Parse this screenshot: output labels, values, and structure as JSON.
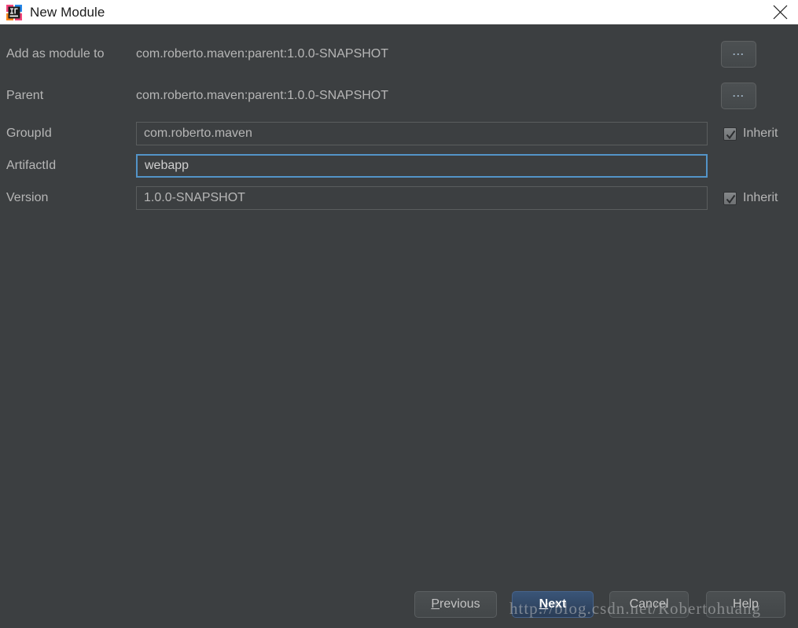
{
  "window": {
    "title": "New Module",
    "app_icon": "intellij-idea-icon",
    "close_icon": "close-icon",
    "titlebar_bg": "#ffffff",
    "body_bg": "#3c3f41"
  },
  "form": {
    "rows": [
      {
        "label": "Add as module to",
        "value": "com.roberto.maven:parent:1.0.0-SNAPSHOT",
        "browse_label": "...",
        "name": "add-as-module-to"
      },
      {
        "label": "Parent",
        "value": "com.roberto.maven:parent:1.0.0-SNAPSHOT",
        "browse_label": "...",
        "name": "parent"
      }
    ],
    "fields": [
      {
        "label": "GroupId",
        "value": "com.roberto.maven",
        "name": "groupid",
        "focused": false,
        "inherit_label": "Inherit",
        "inherit_checked": true
      },
      {
        "label": "ArtifactId",
        "value": "webapp",
        "name": "artifactid",
        "focused": true,
        "inherit_label": "",
        "inherit_checked": false
      },
      {
        "label": "Version",
        "value": "1.0.0-SNAPSHOT",
        "name": "version",
        "focused": false,
        "inherit_label": "Inherit",
        "inherit_checked": true
      }
    ]
  },
  "footer": {
    "previous": {
      "label": "Previous",
      "mnemonic": "P"
    },
    "next": {
      "label": "Next",
      "mnemonic": "N"
    },
    "cancel": {
      "label": "Cancel"
    },
    "help": {
      "label": "Help"
    },
    "default_button_color": "#2f4a6b"
  },
  "watermark": {
    "text": "http://blog.csdn.net/Robertohuang"
  }
}
